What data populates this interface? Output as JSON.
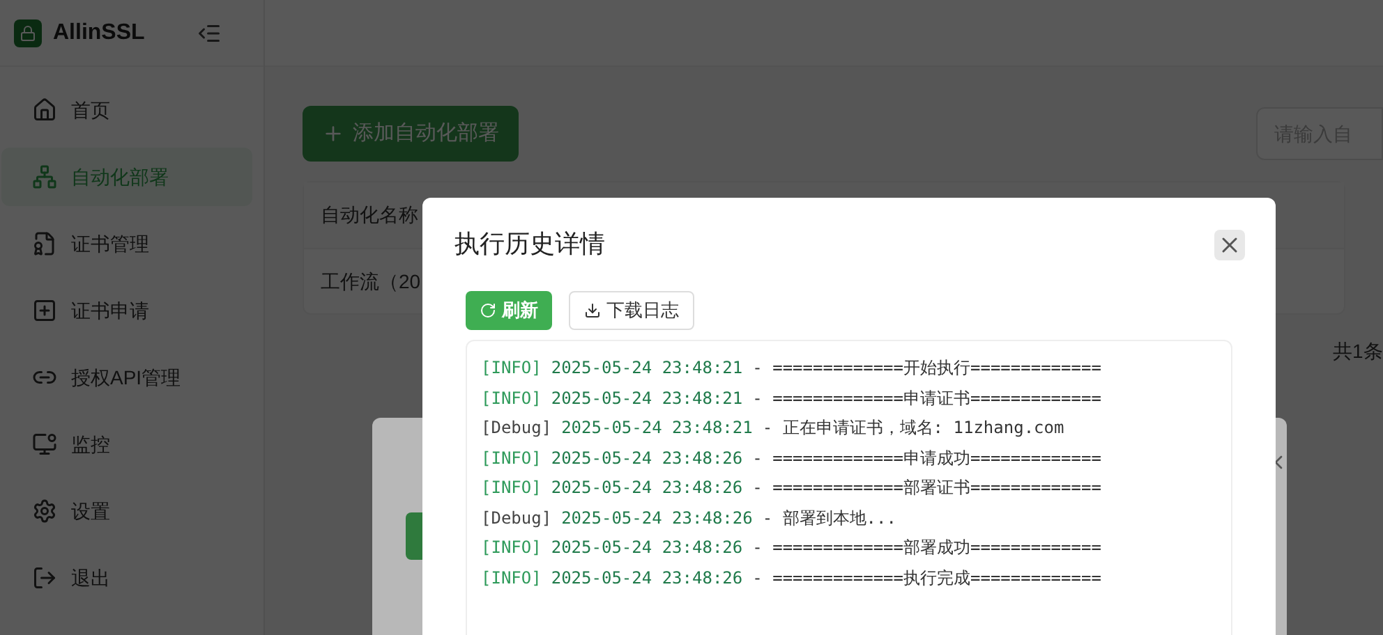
{
  "app": {
    "name": "AllinSSL"
  },
  "sidebar": {
    "items": [
      {
        "label": "首页",
        "selected": false
      },
      {
        "label": "自动化部署",
        "selected": true
      },
      {
        "label": "证书管理",
        "selected": false
      },
      {
        "label": "证书申请",
        "selected": false
      },
      {
        "label": "授权API管理",
        "selected": false
      },
      {
        "label": "监控",
        "selected": false
      },
      {
        "label": "设置",
        "selected": false
      },
      {
        "label": "退出",
        "selected": false
      }
    ]
  },
  "toolbar": {
    "add_button": "添加自动化部署",
    "search": {
      "placeholder": "请输入自"
    }
  },
  "table": {
    "columns": [
      "自动化名称"
    ],
    "rows": [
      [
        "工作流（20"
      ]
    ],
    "footer": "共1条"
  },
  "dialog": {
    "title": "执行历史详情",
    "buttons": [
      {
        "label": "刷新",
        "kind": "primary"
      },
      {
        "label": "下载日志",
        "kind": "default"
      }
    ],
    "log": [
      {
        "kind": "info",
        "tag": "[INFO]",
        "time": "2025-05-24 23:48:21",
        "message": "- =============开始执行============="
      },
      {
        "kind": "info",
        "tag": "[INFO]",
        "time": "2025-05-24 23:48:21",
        "message": "- =============申请证书============="
      },
      {
        "kind": "debug",
        "tag": "[Debug]",
        "time": "2025-05-24 23:48:21",
        "message": "- 正在申请证书，域名: 11zhang.com"
      },
      {
        "kind": "info",
        "tag": "[INFO]",
        "time": "2025-05-24 23:48:26",
        "message": "- =============申请成功============="
      },
      {
        "kind": "info",
        "tag": "[INFO]",
        "time": "2025-05-24 23:48:26",
        "message": "- =============部署证书============="
      },
      {
        "kind": "debug",
        "tag": "[Debug]",
        "time": "2025-05-24 23:48:26",
        "message": "- 部署到本地..."
      },
      {
        "kind": "info",
        "tag": "[INFO]",
        "time": "2025-05-24 23:48:26",
        "message": "- =============部署成功============="
      },
      {
        "kind": "info",
        "tag": "[INFO]",
        "time": "2025-05-24 23:48:26",
        "message": "- =============执行完成============="
      }
    ]
  }
}
